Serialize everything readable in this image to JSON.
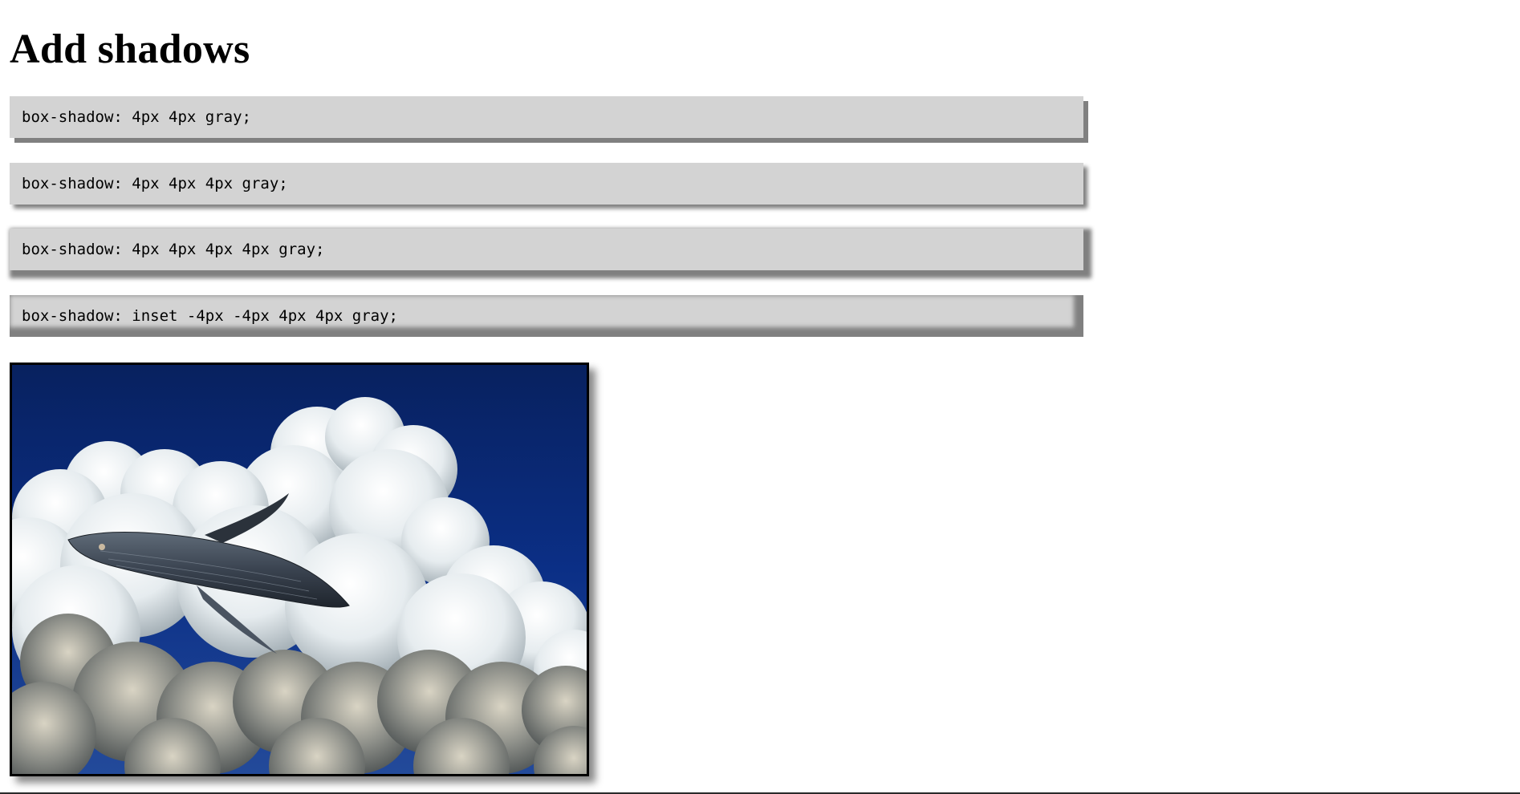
{
  "page": {
    "title": "Add shadows"
  },
  "examples": [
    {
      "code": "box-shadow: 4px 4px gray;"
    },
    {
      "code": "box-shadow: 4px 4px 4px gray;"
    },
    {
      "code": "box-shadow: 4px 4px 4px 4px gray;"
    },
    {
      "code": "box-shadow: inset -4px -4px 4px 4px gray;"
    }
  ],
  "colors": {
    "box_background": "#d3d3d3",
    "shadow": "#808080",
    "sky": "#0a2a7a"
  },
  "image": {
    "subject": "whale-in-clouds-image"
  }
}
